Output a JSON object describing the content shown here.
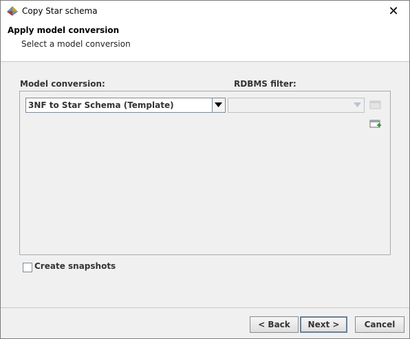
{
  "window": {
    "title": "Copy Star schema",
    "close_glyph": "✕"
  },
  "header": {
    "title": "Apply model conversion",
    "subtitle": "Select a model conversion"
  },
  "form": {
    "model_conversion_label": "Model conversion:",
    "rdbms_filter_label": "RDBMS filter:",
    "model_conversion_value": "3NF to Star Schema (Template)",
    "rdbms_filter_value": "",
    "create_snapshots_label": "Create snapshots",
    "create_snapshots_checked": false
  },
  "buttons": {
    "back": "< Back",
    "next": "Next >",
    "cancel": "Cancel"
  },
  "icons": [
    "app-icon",
    "close-icon",
    "chevron-down-icon",
    "table-icon",
    "add-table-icon"
  ],
  "colors": {
    "add_icon": "#2e9e2e"
  }
}
